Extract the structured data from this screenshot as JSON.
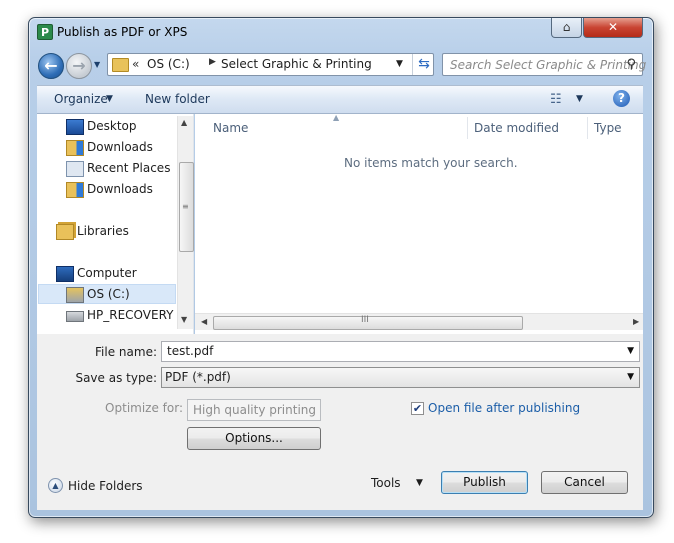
{
  "window": {
    "title": "Publish as PDF or XPS",
    "app_icon_letter": "P",
    "help_caption": "⌂",
    "close_caption": "✕"
  },
  "navigation": {
    "address_prefix": "«",
    "breadcrumbs": [
      "OS (C:)",
      "Select Graphic & Printing"
    ],
    "search_placeholder": "Search Select Graphic & Printing"
  },
  "commandbar": {
    "organize": "Organize",
    "new_folder": "New folder"
  },
  "sidebar": {
    "items": [
      {
        "label": "Desktop",
        "icon": "desktop-icon"
      },
      {
        "label": "Downloads",
        "icon": "downloads-folder-icon"
      },
      {
        "label": "Recent Places",
        "icon": "recent-places-icon"
      },
      {
        "label": "Downloads",
        "icon": "downloads-folder-icon"
      },
      {
        "label": "Libraries",
        "icon": "libraries-icon"
      },
      {
        "label": "Computer",
        "icon": "computer-icon"
      },
      {
        "label": "OS (C:)",
        "icon": "os-drive-icon",
        "selected": true
      },
      {
        "label": "HP_RECOVERY (D",
        "icon": "drive-icon"
      }
    ]
  },
  "filelist": {
    "columns": [
      "Name",
      "Date modified",
      "Type"
    ],
    "empty_message": "No items match your search."
  },
  "form": {
    "file_name_label": "File name:",
    "file_name_value": "test.pdf",
    "save_type_label": "Save as type:",
    "save_type_value": "PDF (*.pdf)",
    "optimize_label": "Optimize for:",
    "optimize_value": "High quality printing",
    "options_button": "Options...",
    "open_after_label": "Open file after publishing",
    "open_after_checked": true
  },
  "footer": {
    "hide_folders": "Hide Folders",
    "tools": "Tools",
    "publish": "Publish",
    "cancel": "Cancel"
  },
  "colors": {
    "frame": "#b8cfe9",
    "link_blue": "#1c5ea8",
    "selection": "#d9e8f9"
  }
}
